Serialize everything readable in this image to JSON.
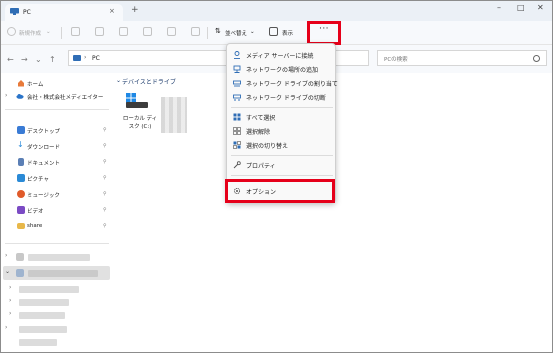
{
  "tab": {
    "title": "PC",
    "close": "×",
    "new_tab": "+"
  },
  "window_controls": {
    "minimize": "–",
    "maximize": "□",
    "close": "✕"
  },
  "toolbar": {
    "new_label": "新規作成",
    "new_chevron": "⌄",
    "sort_label": "並べ替え",
    "sort_chevron": "⌄",
    "view_label": "表示",
    "more_label": "···"
  },
  "address": {
    "back": "←",
    "forward": "→",
    "dropdown": "⌄",
    "up": "↑",
    "chevron": "›",
    "path": "PC",
    "search_placeholder": "PCの検索"
  },
  "sidebar": {
    "home": "ホーム",
    "cloud": "会社・株式会社メディエイター",
    "quick": [
      {
        "label": "デスクトップ",
        "icon": "desktop-icon",
        "color": "#3a7bd5"
      },
      {
        "label": "ダウンロード",
        "icon": "download-icon",
        "color": "#2d8cdb"
      },
      {
        "label": "ドキュメント",
        "icon": "documents-icon",
        "color": "#5b7fb5"
      },
      {
        "label": "ピクチャ",
        "icon": "pictures-icon",
        "color": "#2a8ad6"
      },
      {
        "label": "ミュージック",
        "icon": "music-icon",
        "color": "#e05a2a"
      },
      {
        "label": "ビデオ",
        "icon": "videos-icon",
        "color": "#7b4bc4"
      },
      {
        "label": "share",
        "icon": "folder-icon",
        "color": "#e8b84a"
      }
    ],
    "pin": "📌"
  },
  "content": {
    "section_title": "デバイスとドライブ",
    "section_chevron": "⌄",
    "drive_label": "ローカル ディスク (C:)"
  },
  "menu": {
    "items": [
      {
        "label": "メディア サーバーに接続",
        "icon": "media-server-icon"
      },
      {
        "label": "ネットワークの場所の追加",
        "icon": "network-location-icon"
      },
      {
        "label": "ネットワーク ドライブの割り当て",
        "icon": "map-drive-icon"
      },
      {
        "label": "ネットワーク ドライブの切断",
        "icon": "disconnect-drive-icon"
      },
      {
        "label": "すべて選択",
        "icon": "select-all-icon"
      },
      {
        "label": "選択解除",
        "icon": "select-none-icon"
      },
      {
        "label": "選択の切り替え",
        "icon": "invert-selection-icon"
      },
      {
        "label": "プロパティ",
        "icon": "properties-icon"
      },
      {
        "label": "オプション",
        "icon": "options-icon"
      }
    ]
  },
  "colors": {
    "highlight": "#e6001a",
    "accent": "#2f6db5"
  }
}
